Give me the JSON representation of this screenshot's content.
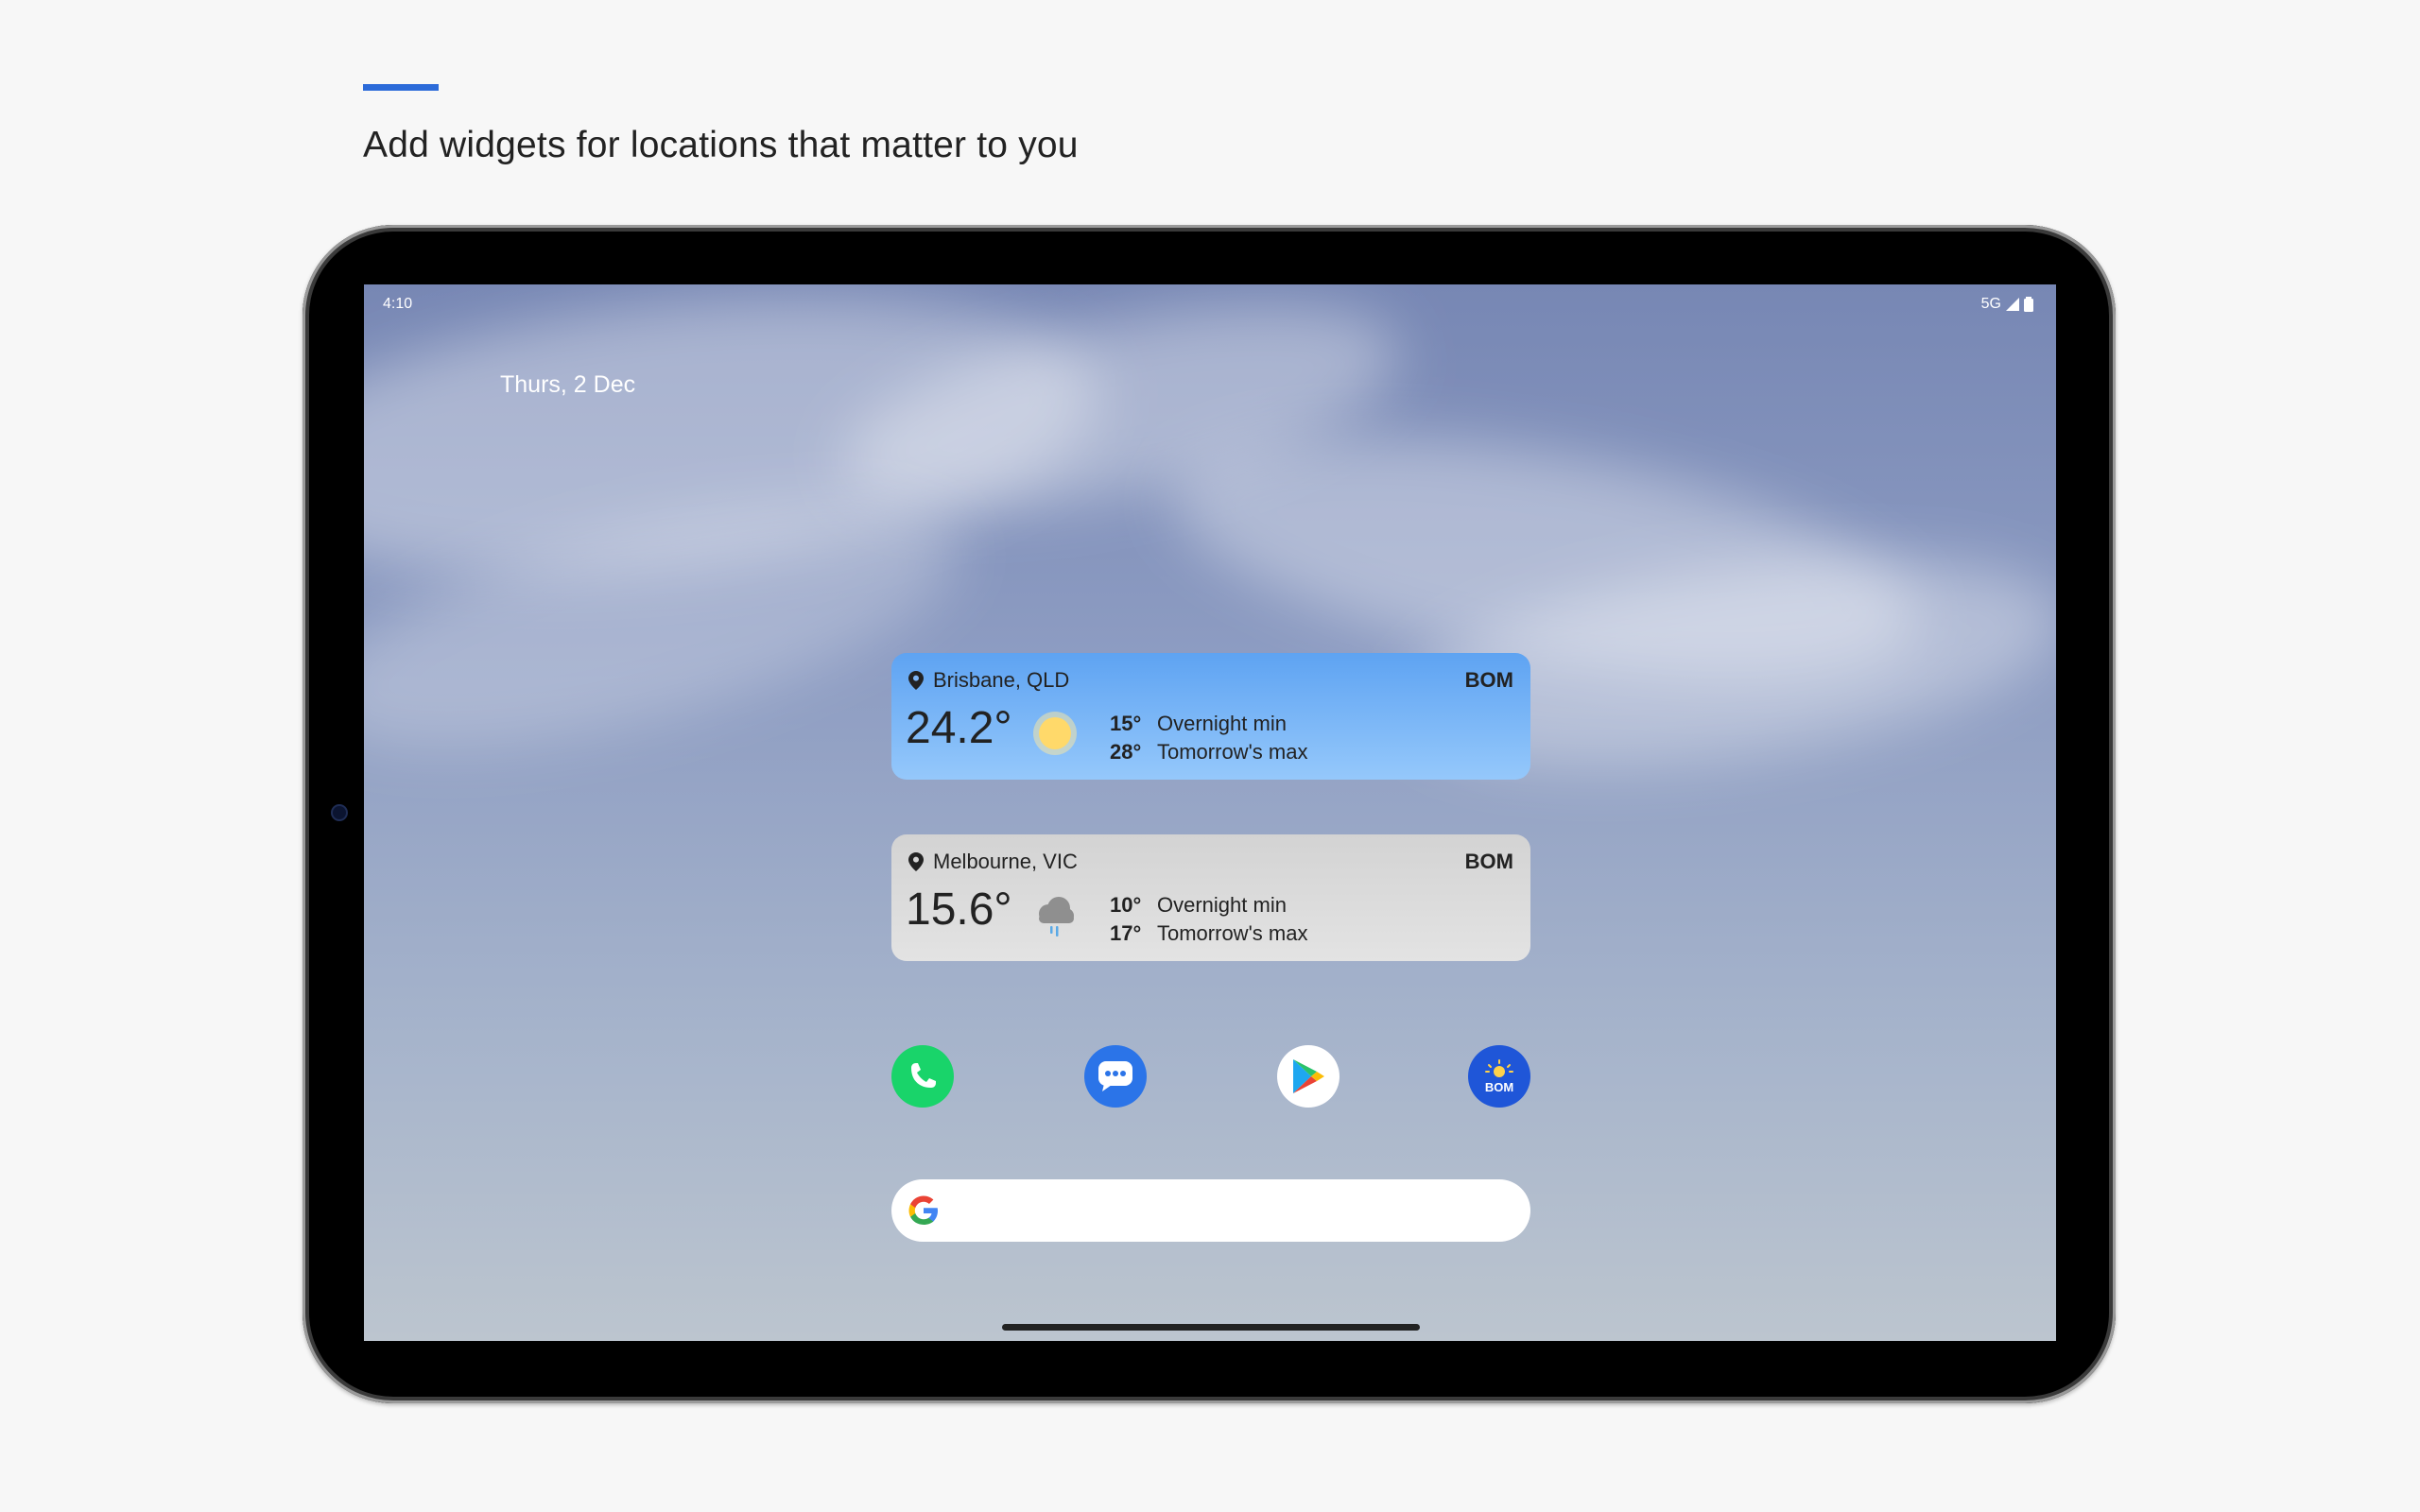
{
  "page": {
    "headline": "Add widgets for locations that matter to you",
    "accent_color": "#2c6bd9"
  },
  "status_bar": {
    "time": "4:10",
    "network": "5G",
    "icons": [
      "signal-icon",
      "battery-icon"
    ]
  },
  "home": {
    "date": "Thurs, 2 Dec"
  },
  "widgets": [
    {
      "location": "Brisbane, QLD",
      "source": "BOM",
      "temp": "24.2°",
      "condition_icon": "sun-icon",
      "min_temp": "15°",
      "min_label": "Overnight min",
      "max_temp": "28°",
      "max_label": "Tomorrow's max"
    },
    {
      "location": "Melbourne, VIC",
      "source": "BOM",
      "temp": "15.6°",
      "condition_icon": "rain-cloud-icon",
      "min_temp": "10°",
      "min_label": "Overnight min",
      "max_temp": "17°",
      "max_label": "Tomorrow's max"
    }
  ],
  "dock": {
    "apps": [
      {
        "name": "phone",
        "icon": "phone-icon"
      },
      {
        "name": "messages",
        "icon": "messages-icon"
      },
      {
        "name": "play-store",
        "icon": "play-store-icon"
      },
      {
        "name": "bom",
        "icon": "bom-weather-icon",
        "label": "BOM"
      }
    ]
  },
  "search": {
    "icon": "google-g-icon"
  },
  "colors": {
    "widget_sunny": "#5ea3f2",
    "widget_cloudy": "#d3d3d3",
    "phone_green": "#19d46a",
    "messages_blue": "#2b74e8",
    "bom_blue": "#1f56d8"
  }
}
